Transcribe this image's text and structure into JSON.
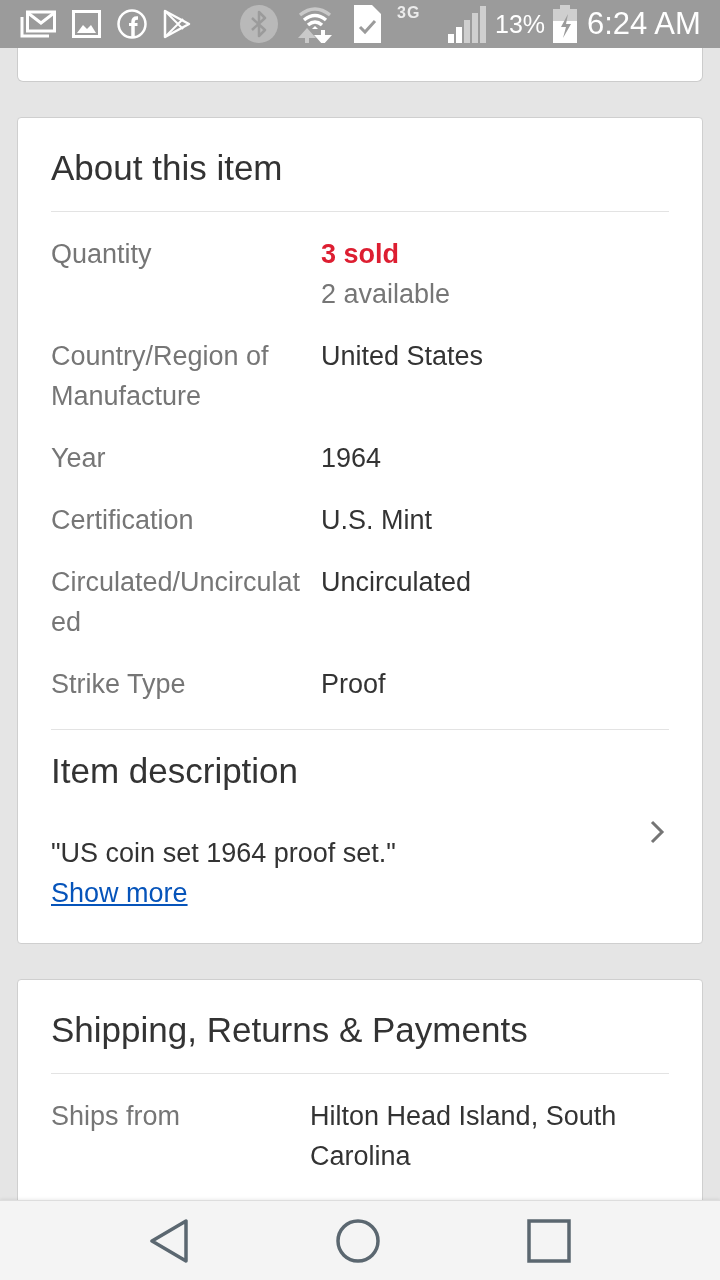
{
  "status_bar": {
    "network": "3G",
    "battery": "13%",
    "time": "6:24 AM"
  },
  "cards": [
    {
      "title": "About this item",
      "rows": [
        {
          "label": "Quantity",
          "values": [
            {
              "text": "3 sold",
              "kind": "sold"
            },
            {
              "text": "2 available",
              "kind": "note"
            }
          ]
        },
        {
          "label": "Country/Region of Manufacture",
          "values": [
            {
              "text": "United States",
              "kind": "plain"
            }
          ]
        },
        {
          "label": "Year",
          "values": [
            {
              "text": "1964",
              "kind": "plain"
            }
          ]
        },
        {
          "label": "Certification",
          "values": [
            {
              "text": "U.S. Mint",
              "kind": "plain"
            }
          ]
        },
        {
          "label": "Circulated/Uncirculated",
          "values": [
            {
              "text": "Uncirculated",
              "kind": "plain"
            }
          ]
        },
        {
          "label": "Strike Type",
          "values": [
            {
              "text": "Proof",
              "kind": "plain"
            }
          ]
        }
      ],
      "description": {
        "title": "Item description",
        "text": "\"US coin set 1964 proof set.\"",
        "link": "Show more"
      }
    },
    {
      "title": "Shipping, Returns & Payments",
      "rows": [
        {
          "label": "Ships from",
          "values": [
            {
              "text": "Hilton Head Island, South Carolina",
              "kind": "plain"
            }
          ]
        }
      ]
    }
  ]
}
